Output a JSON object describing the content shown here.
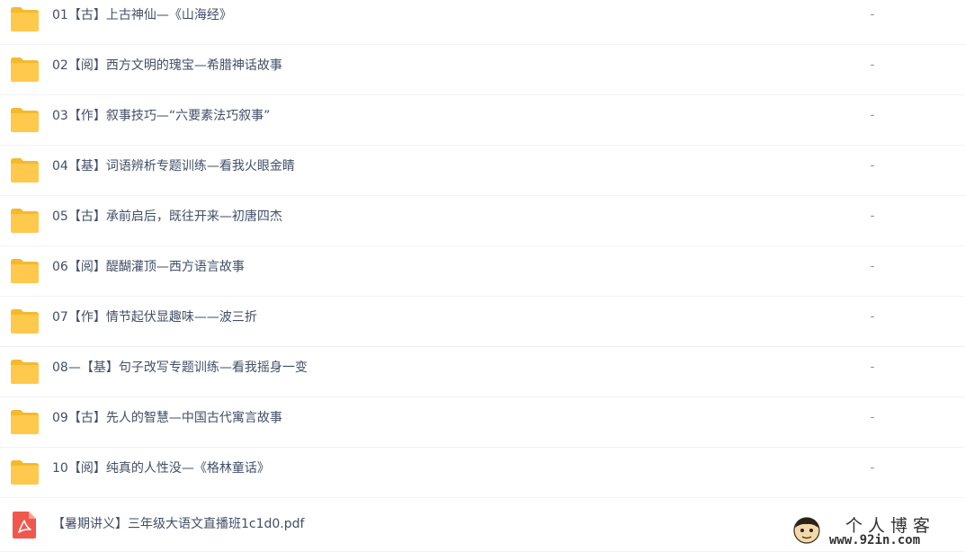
{
  "files": [
    {
      "name": "01【古】上古神仙—《山海经》",
      "size": "-",
      "icon": "folder-icon"
    },
    {
      "name": "02【阅】西方文明的瑰宝—希腊神话故事",
      "size": "-",
      "icon": "folder-icon"
    },
    {
      "name": "03【作】叙事技巧—“六要素法巧叙事”",
      "size": "-",
      "icon": "folder-icon"
    },
    {
      "name": "04【基】词语辨析专题训练—看我火眼金睛",
      "size": "-",
      "icon": "folder-icon"
    },
    {
      "name": "05【古】承前启后，既往开来—初唐四杰",
      "size": "-",
      "icon": "folder-icon"
    },
    {
      "name": "06【阅】醍醐灌顶—西方语言故事",
      "size": "-",
      "icon": "folder-icon"
    },
    {
      "name": "07【作】情节起伏显趣味——波三折",
      "size": "-",
      "icon": "folder-icon"
    },
    {
      "name": "08—【基】句子改写专题训练—看我摇身一变",
      "size": "-",
      "icon": "folder-icon"
    },
    {
      "name": "09【古】先人的智慧—中国古代寓言故事",
      "size": "-",
      "icon": "folder-icon"
    },
    {
      "name": "10【阅】纯真的人性没—《格林童话》",
      "size": "-",
      "icon": "folder-icon"
    },
    {
      "name": "【暑期讲义】三年级大语文直播班1c1d0.pdf",
      "size": "",
      "icon": "pdf-icon"
    }
  ],
  "watermark": {
    "title": "个人博客",
    "url": "www.92in.com"
  },
  "colors": {
    "folder": "#ffc94d",
    "folder_tab": "#f6b92c",
    "pdf": "#f0574d",
    "text": "#424e67",
    "divider": "#f1f2f4"
  }
}
